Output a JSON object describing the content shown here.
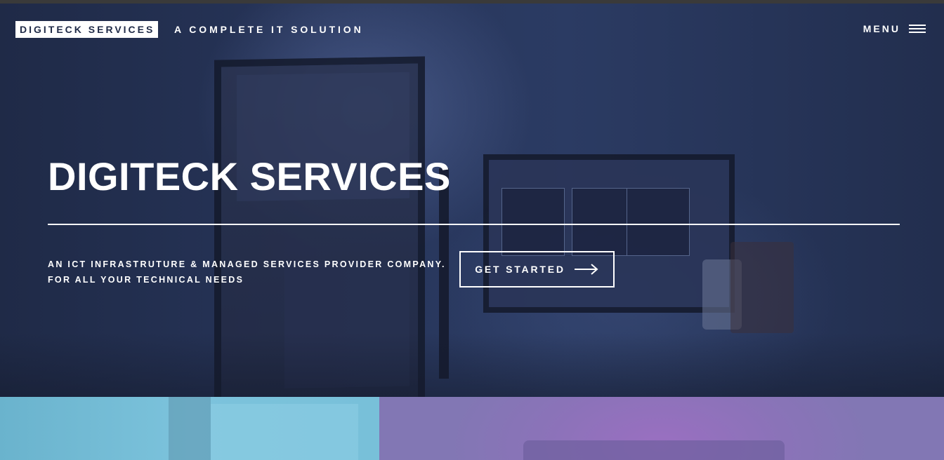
{
  "header": {
    "brand": "DIGITECK SERVICES",
    "tagline": "A COMPLETE IT SOLUTION",
    "menu_label": "MENU",
    "menu_icon": "hamburger-icon"
  },
  "hero": {
    "title": "DIGITECK SERVICES",
    "subtitle_line1": "AN ICT INFRASTRUTURE & MANAGED SERVICES PROVIDER COMPANY.",
    "subtitle_line2": "FOR ALL YOUR TECHNICAL NEEDS",
    "cta_label": "GET STARTED",
    "cta_icon": "arrow-right-icon"
  },
  "colors": {
    "hero_overlay": "#1f2a47",
    "accent_text": "#ffffff",
    "panel_left": "#72bbd4",
    "panel_right": "#8a73b8"
  }
}
